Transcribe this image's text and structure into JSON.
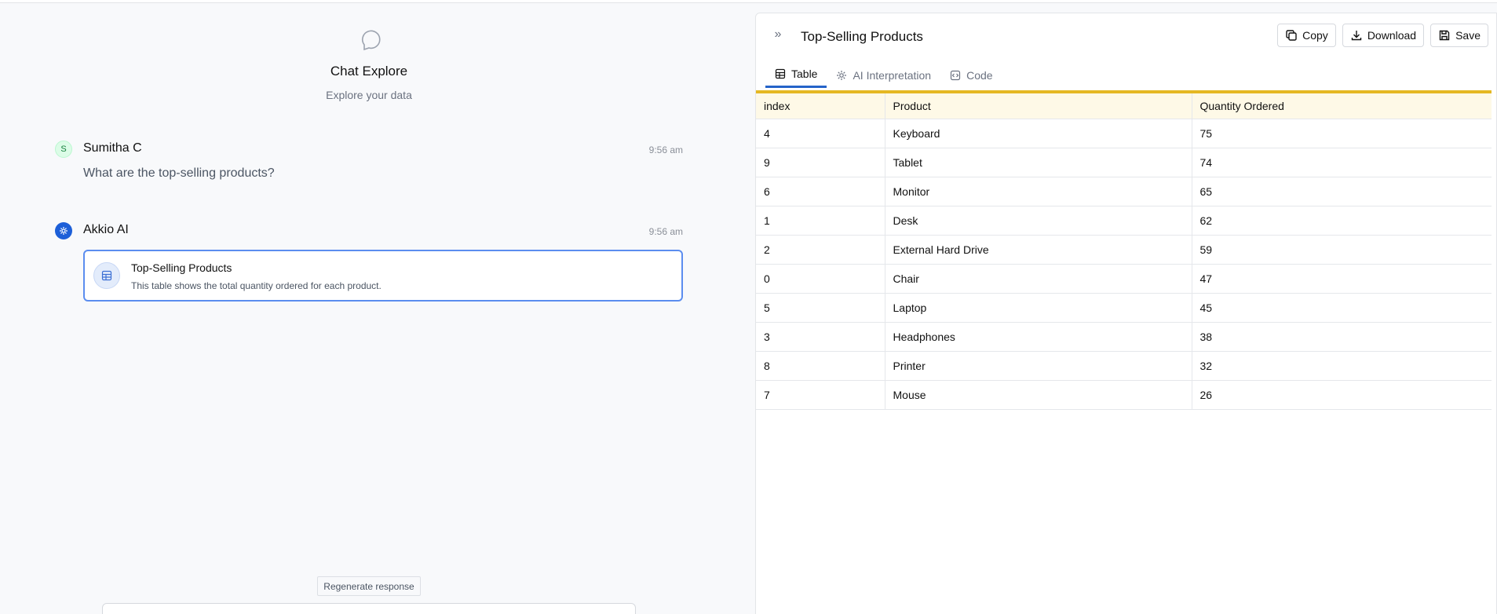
{
  "chat": {
    "title": "Chat Explore",
    "subtitle": "Explore your data",
    "messages": [
      {
        "avatar": "S",
        "name": "Sumitha C",
        "time": "9:56 am",
        "text": "What are the top-selling products?"
      },
      {
        "name": "Akkio AI",
        "time": "9:56 am",
        "card": {
          "title": "Top-Selling Products",
          "description": "This table shows the total quantity ordered for each product."
        }
      }
    ],
    "regenerate_label": "Regenerate response"
  },
  "panel": {
    "title": "Top-Selling Products",
    "buttons": {
      "copy": "Copy",
      "download": "Download",
      "save": "Save"
    },
    "tabs": [
      {
        "label": "Table",
        "icon": "table-icon",
        "active": true
      },
      {
        "label": "AI Interpretation",
        "icon": "ai-gear-icon",
        "active": false
      },
      {
        "label": "Code",
        "icon": "code-icon",
        "active": false
      }
    ],
    "table": {
      "headers": [
        "index",
        "Product",
        "Quantity Ordered"
      ],
      "rows": [
        [
          "4",
          "Keyboard",
          "75"
        ],
        [
          "9",
          "Tablet",
          "74"
        ],
        [
          "6",
          "Monitor",
          "65"
        ],
        [
          "1",
          "Desk",
          "62"
        ],
        [
          "2",
          "External Hard Drive",
          "59"
        ],
        [
          "0",
          "Chair",
          "47"
        ],
        [
          "5",
          "Laptop",
          "45"
        ],
        [
          "3",
          "Headphones",
          "38"
        ],
        [
          "8",
          "Printer",
          "32"
        ],
        [
          "7",
          "Mouse",
          "26"
        ]
      ]
    }
  },
  "colors": {
    "accent": "#2563c9",
    "header_stripe": "#e5b823",
    "ai_avatar": "#1d5fd8"
  }
}
